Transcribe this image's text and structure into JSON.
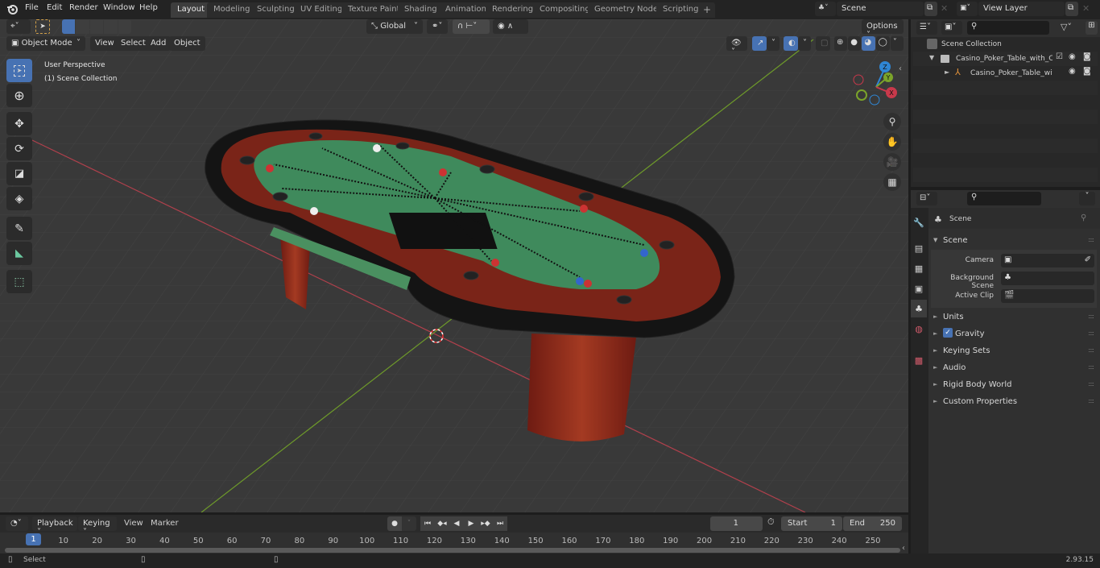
{
  "app": {
    "version": "2.93.15"
  },
  "menubar": {
    "items": [
      "File",
      "Edit",
      "Render",
      "Window",
      "Help"
    ]
  },
  "workspaces": {
    "tabs": [
      "Layout",
      "Modeling",
      "Sculpting",
      "UV Editing",
      "Texture Paint",
      "Shading",
      "Animation",
      "Rendering",
      "Compositing",
      "Geometry Nodes",
      "Scripting"
    ],
    "active": "Layout",
    "add_label": "+"
  },
  "scene_selector": {
    "value": "Scene"
  },
  "view_layer_selector": {
    "value": "View Layer"
  },
  "viewport": {
    "mode": "Object Mode",
    "menus": [
      "View",
      "Select",
      "Add",
      "Object"
    ],
    "transform_orientation": "Global",
    "options_label": "Options",
    "overlay_text": {
      "line1": "User Perspective",
      "line2": "(1) Scene Collection"
    },
    "gizmo_axes": {
      "x": "X",
      "y": "Y",
      "z": "Z"
    },
    "colors": {
      "x_axis": "#c8394b",
      "y_axis": "#7ba42a",
      "z_axis": "#2f86d4",
      "felt": "#3f8a5c",
      "wood": "#8a2a1c",
      "rail": "#141414"
    },
    "tools": [
      "select-box",
      "cursor",
      "move",
      "rotate",
      "scale",
      "transform",
      "annotate",
      "measure",
      "add-cube"
    ]
  },
  "outliner": {
    "search_placeholder": "",
    "root": "Scene Collection",
    "items": [
      {
        "label": "Casino_Poker_Table_with_Car",
        "type": "collection",
        "checked": true
      },
      {
        "label": "Casino_Poker_Table_with",
        "type": "object"
      }
    ]
  },
  "properties": {
    "search_placeholder": "",
    "context_title": "Scene",
    "panel_title": "Scene",
    "fields": [
      {
        "label": "Camera",
        "value": ""
      },
      {
        "label": "Background Scene",
        "value": ""
      },
      {
        "label": "Active Clip",
        "value": ""
      }
    ],
    "subpanels": [
      {
        "label": "Units"
      },
      {
        "label": "Gravity",
        "checkbox": true
      },
      {
        "label": "Keying Sets"
      },
      {
        "label": "Audio"
      },
      {
        "label": "Rigid Body World"
      },
      {
        "label": "Custom Properties"
      }
    ]
  },
  "timeline": {
    "menus": [
      "Playback",
      "Keying",
      "View",
      "Marker"
    ],
    "current_frame": "1",
    "start_label": "Start",
    "start": "1",
    "end_label": "End",
    "end": "250",
    "ticks": [
      "10",
      "20",
      "30",
      "40",
      "50",
      "60",
      "70",
      "80",
      "90",
      "100",
      "110",
      "120",
      "130",
      "140",
      "150",
      "160",
      "170",
      "180",
      "190",
      "200",
      "210",
      "220",
      "230",
      "240",
      "250"
    ],
    "playhead": "1"
  },
  "statusbar": {
    "left_label": "Select"
  }
}
